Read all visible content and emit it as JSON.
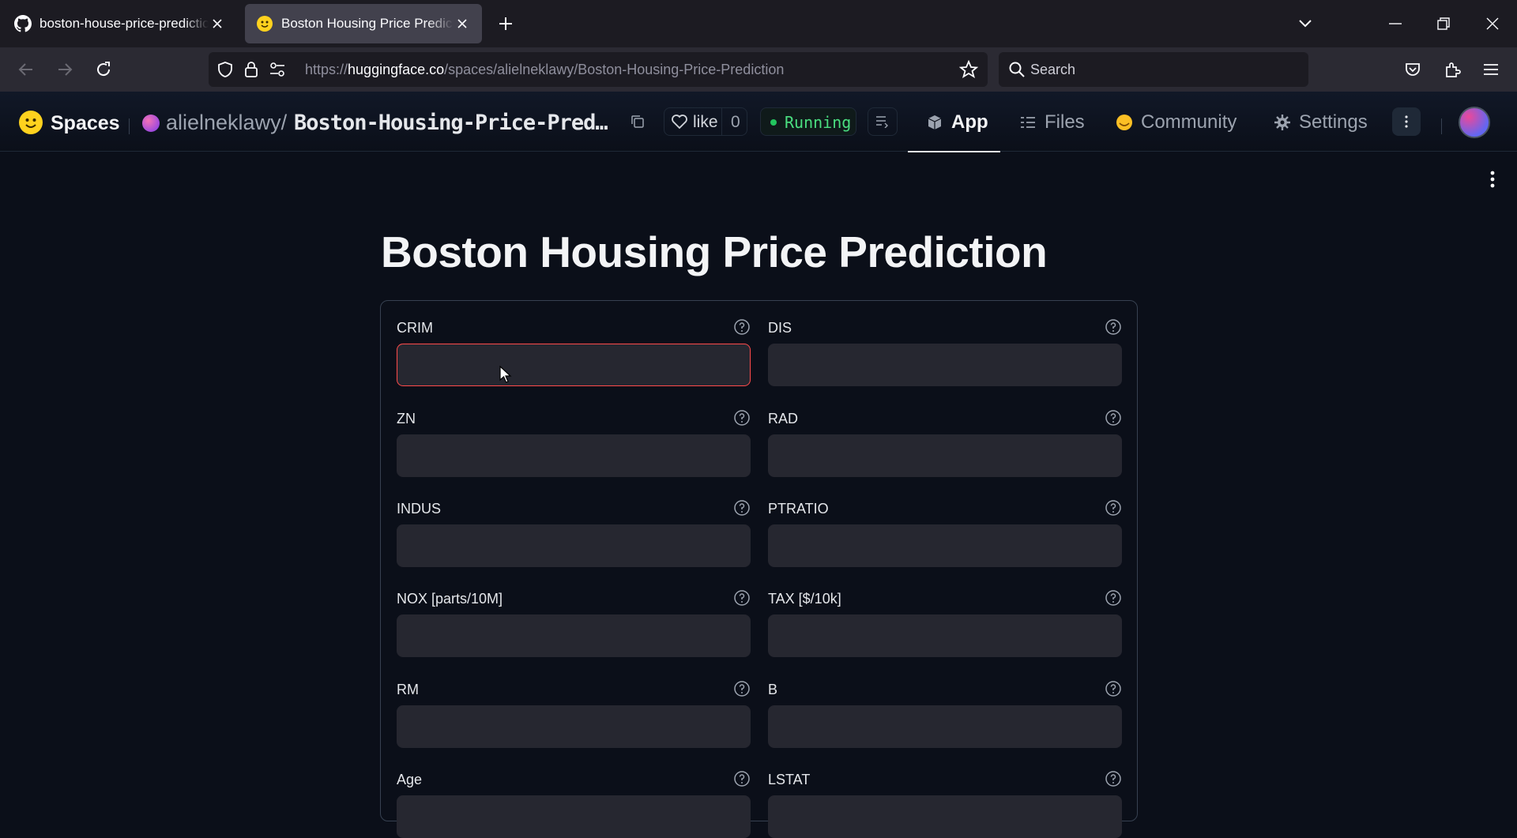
{
  "browser": {
    "tabs": [
      {
        "title": "boston-house-price-prediction/r",
        "icon": "github-icon",
        "active": false
      },
      {
        "title": "Boston Housing Price Prediction",
        "icon": "huggingface-icon",
        "active": true
      }
    ],
    "url": {
      "prefix": "https://",
      "host": "huggingface.co",
      "path": "/spaces/alielneklawy/Boston-Housing-Price-Prediction"
    },
    "search_placeholder": "Search"
  },
  "hf_header": {
    "brand": "Spaces",
    "owner": "alielneklawy",
    "slash": "/",
    "repo": "Boston-Housing-Price-Pred…",
    "like_label": "like",
    "like_count": "0",
    "status": "Running",
    "status_color": "#4ade80",
    "tabs": [
      {
        "label": "App",
        "icon": "cube-icon",
        "active": true
      },
      {
        "label": "Files",
        "icon": "files-icon",
        "active": false
      },
      {
        "label": "Community",
        "icon": "community-icon",
        "active": false
      },
      {
        "label": "Settings",
        "icon": "gear-icon",
        "active": false
      }
    ]
  },
  "app": {
    "title": "Boston Housing Price Prediction",
    "fields": [
      {
        "label": "CRIM",
        "value": "",
        "focused": true
      },
      {
        "label": "DIS",
        "value": ""
      },
      {
        "label": "ZN",
        "value": ""
      },
      {
        "label": "RAD",
        "value": ""
      },
      {
        "label": "INDUS",
        "value": ""
      },
      {
        "label": "PTRATIO",
        "value": ""
      },
      {
        "label": "NOX [parts/10M]",
        "value": ""
      },
      {
        "label": "TAX [$/10k]",
        "value": ""
      },
      {
        "label": "RM",
        "value": ""
      },
      {
        "label": "B",
        "value": ""
      },
      {
        "label": "Age",
        "value": ""
      },
      {
        "label": "LSTAT",
        "value": ""
      }
    ],
    "accent": "#ff4b4b"
  }
}
